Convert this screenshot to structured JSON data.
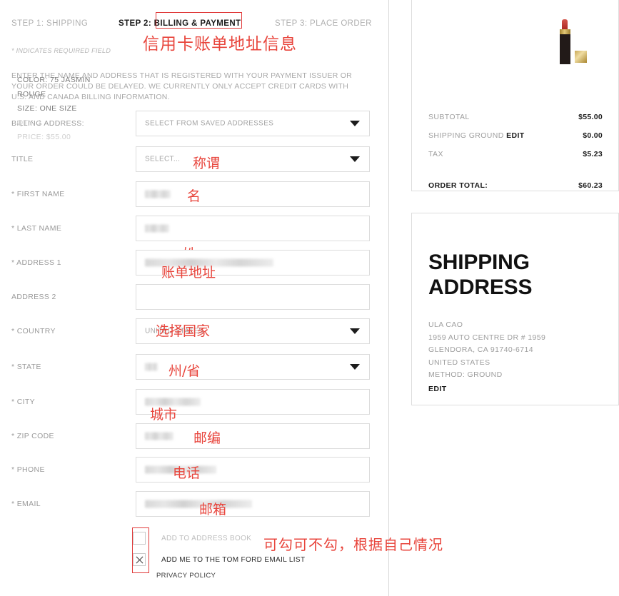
{
  "checkout": {
    "steps": [
      {
        "label": "STEP 1: SHIPPING",
        "state": "inactive"
      },
      {
        "label": "STEP 2: BILLING & PAYMENT",
        "state": "active"
      },
      {
        "label": "STEP 3: PLACE ORDER",
        "state": "inactive"
      }
    ],
    "step2_prefix": "STEP 2:",
    "step2_highlight": "BILLING & PAYMENT",
    "required_note": "* INDICATES REQUIRED FIELD",
    "intro": "ENTER THE NAME AND ADDRESS THAT IS REGISTERED WITH YOUR PAYMENT ISSUER OR YOUR ORDER COULD BE DELAYED. WE CURRENTLY ONLY ACCEPT CREDIT CARDS WITH U.S. AND CANADA BILLING INFORMATION."
  },
  "annotations": {
    "title": "信用卡账单地址信息",
    "title_color": "#e8453c",
    "checkbox_note": "可勾可不勾，根据自己情况",
    "fields": {
      "title": "称谓",
      "first_name": "名",
      "last_name": "姓",
      "address1": "账单地址",
      "country": "选择国家",
      "state": "州/省",
      "city": "城市",
      "zip": "邮编",
      "phone": "电话",
      "email": "邮箱"
    }
  },
  "form": {
    "fields": [
      {
        "label": "BILLING ADDRESS:",
        "type": "select",
        "value": "SELECT FROM SAVED ADDRESSES",
        "required": false,
        "redacted": false
      },
      {
        "label": "TITLE",
        "type": "select",
        "value": "SELECT...",
        "required": false,
        "redacted": false
      },
      {
        "label": "* FIRST NAME",
        "type": "text",
        "value": "",
        "required": true,
        "redacted": true
      },
      {
        "label": "* LAST NAME",
        "type": "text",
        "value": "",
        "required": true,
        "redacted": true
      },
      {
        "label": "* ADDRESS 1",
        "type": "text",
        "value": "",
        "required": true,
        "redacted": true
      },
      {
        "label": "ADDRESS 2",
        "type": "text",
        "value": "",
        "required": false,
        "redacted": false
      },
      {
        "label": "* COUNTRY",
        "type": "select",
        "value": "UNITED STATES",
        "required": true,
        "redacted": false
      },
      {
        "label": "* STATE",
        "type": "select",
        "value": "",
        "required": true,
        "redacted": true
      },
      {
        "label": "* CITY",
        "type": "text",
        "value": "",
        "required": true,
        "redacted": true
      },
      {
        "label": "* ZIP CODE",
        "type": "text",
        "value": "",
        "required": true,
        "redacted": true
      },
      {
        "label": "* PHONE",
        "type": "text",
        "value": "",
        "required": true,
        "redacted": true
      },
      {
        "label": "* EMAIL",
        "type": "text",
        "value": "",
        "required": true,
        "redacted": true
      }
    ],
    "checkboxes": [
      {
        "label": "ADD TO ADDRESS BOOK",
        "checked": false
      },
      {
        "label": "ADD ME TO THE TOM FORD EMAIL LIST",
        "checked": true
      }
    ],
    "privacy_link": "PRIVACY POLICY"
  },
  "cart": {
    "product": {
      "color": "COLOR: 75 JASMIN",
      "color_line2": "ROUGE",
      "size": "SIZE: ONE SIZE",
      "qty": "QTY: 1",
      "price": "PRICE: $55.00",
      "image": "lipstick-product-image"
    },
    "totals": [
      {
        "label": "SUBTOTAL",
        "value": "$55.00",
        "emphasis": false
      },
      {
        "label": "SHIPPING GROUND",
        "edit": "EDIT",
        "value": "$0.00",
        "emphasis": false
      },
      {
        "label": "TAX",
        "value": "$5.23",
        "emphasis": false
      }
    ],
    "order_total": {
      "label": "ORDER TOTAL:",
      "value": "$60.23"
    }
  },
  "shipping_address": {
    "title": "SHIPPING ADDRESS",
    "lines": [
      "ULA CAO",
      "1959 AUTO CENTRE DR # 1959",
      "GLENDORA, CA 91740-6714",
      "UNITED STATES",
      "METHOD: GROUND"
    ],
    "edit": "EDIT"
  }
}
